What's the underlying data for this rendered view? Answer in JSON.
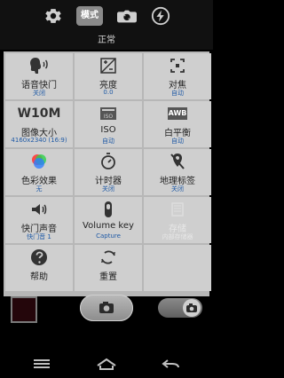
{
  "top": {
    "icons": [
      "settings-icon",
      "mode-button",
      "swap-camera-icon",
      "flash-icon"
    ],
    "mode_button_label": "模式",
    "current_mode": "正常"
  },
  "grid": {
    "items": [
      {
        "label": "语音快门",
        "value": "关闭",
        "icon": "voice-shutter-icon"
      },
      {
        "label": "亮度",
        "value": "0.0",
        "icon": "brightness-icon"
      },
      {
        "label": "对焦",
        "value": "自动",
        "icon": "focus-icon"
      },
      {
        "label": "图像大小",
        "value": "4160x2340 (16:9)",
        "icon": "image-size-icon",
        "icon_text": "W10M"
      },
      {
        "label": "ISO",
        "value": "自动",
        "icon": "iso-icon"
      },
      {
        "label": "白平衡",
        "value": "自动",
        "icon": "white-balance-icon",
        "icon_text": "AWB"
      },
      {
        "label": "色彩效果",
        "value": "无",
        "icon": "color-effect-icon"
      },
      {
        "label": "计时器",
        "value": "关闭",
        "icon": "timer-icon"
      },
      {
        "label": "地理标签",
        "value": "关闭",
        "icon": "geotag-icon"
      },
      {
        "label": "快门声音",
        "value": "快门音 1",
        "icon": "shutter-sound-icon"
      },
      {
        "label": "Volume key",
        "value": "Capture",
        "icon": "volume-key-icon"
      },
      {
        "label": "存储",
        "value": "内部存储器",
        "icon": "storage-icon",
        "disabled": true
      },
      {
        "label": "帮助",
        "value": "",
        "icon": "help-icon"
      },
      {
        "label": "重置",
        "value": "",
        "icon": "reset-icon"
      },
      {
        "label": "",
        "value": "",
        "icon": ""
      }
    ]
  },
  "bottom": {
    "thumbnail": "last-photo-thumbnail",
    "shutter": "shutter-button",
    "camera_video_toggle": "camera-video-toggle"
  },
  "nav": {
    "icons": [
      "menu-icon",
      "home-icon",
      "back-icon"
    ]
  },
  "colors": {
    "grid_bg": "#cfcfcf",
    "grid_lines": "#b7b7b7",
    "value_blue": "#1f5aa6",
    "top_bar_bg": "#111111"
  }
}
